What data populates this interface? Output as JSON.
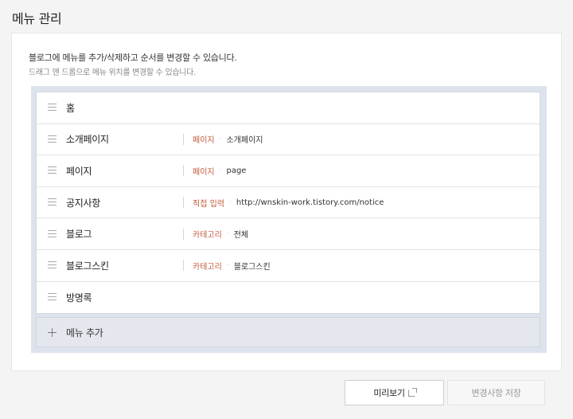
{
  "header": {
    "title": "메뉴 관리"
  },
  "description": {
    "main": "블로그에 메뉴를 추가/삭제하고 순서를 변경할 수 있습니다.",
    "sub": "드래그 앤 드롭으로 메뉴 위치를 변경할 수 있습니다."
  },
  "menu": {
    "items": [
      {
        "name": "홈",
        "type": "",
        "target": ""
      },
      {
        "name": "소개페이지",
        "type": "페이지",
        "target": "소개페이지"
      },
      {
        "name": "페이지",
        "type": "페이지",
        "target": "page"
      },
      {
        "name": "공지사항",
        "type": "직접 입력",
        "target": "http://wnskin-work.tistory.com/notice"
      },
      {
        "name": "블로그",
        "type": "카테고리",
        "target": "전체"
      },
      {
        "name": "블로그스킨",
        "type": "카테고리",
        "target": "블로그스킨"
      },
      {
        "name": "방명록",
        "type": "",
        "target": ""
      }
    ],
    "separator": "·",
    "add_label": "메뉴 추가"
  },
  "buttons": {
    "preview": "미리보기",
    "save": "변경사항 저장"
  },
  "colors": {
    "type_accent": "#c35a3b",
    "menu_area_bg": "#dde3ec"
  }
}
